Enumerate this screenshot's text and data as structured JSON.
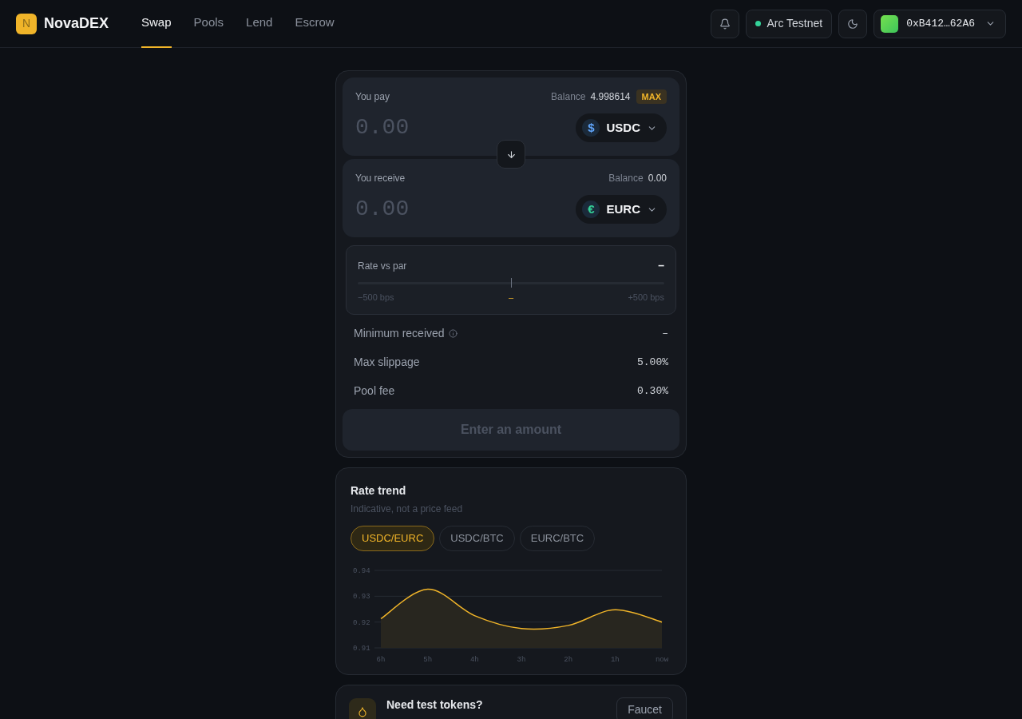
{
  "brand": {
    "logo": "N",
    "name": "NovaDEX"
  },
  "nav": [
    {
      "label": "Swap",
      "selected": true
    },
    {
      "label": "Pools",
      "selected": false
    },
    {
      "label": "Lend",
      "selected": false
    },
    {
      "label": "Escrow",
      "selected": false
    }
  ],
  "header": {
    "network": {
      "label": "Arc Testnet",
      "color": "#34d399"
    },
    "wallet": "0xB412…62A6"
  },
  "swap": {
    "pay": {
      "label": "You pay",
      "balance_label": "Balance",
      "balance": "4.998614",
      "max": "MAX",
      "placeholder": "0.00",
      "token": "USDC",
      "token_symbol": "$",
      "color": "#60a5fa"
    },
    "receive": {
      "label": "You receive",
      "balance_label": "Balance",
      "balance": "0.00",
      "placeholder": "0.00",
      "token": "EURC",
      "token_symbol": "€",
      "color": "#34d399"
    },
    "rate": {
      "label": "Rate vs par",
      "value": "–",
      "level": 0.5,
      "min": "−500 bps",
      "center": "–",
      "max": "+500 bps"
    },
    "details": [
      {
        "label": "Minimum received",
        "info": true,
        "value": "–"
      },
      {
        "label": "Max slippage",
        "info": false,
        "value": "5.00%"
      },
      {
        "label": "Pool fee",
        "info": false,
        "value": "0.30%"
      }
    ],
    "submit": {
      "label": "Enter an amount",
      "disabled": true
    }
  },
  "trend": {
    "title": "Rate trend",
    "subtitle": "Indicative, not a price feed",
    "pairs": [
      {
        "label": "USDC/EURC",
        "selected": true
      },
      {
        "label": "USDC/BTC",
        "selected": false
      },
      {
        "label": "EURC/BTC",
        "selected": false
      }
    ],
    "chart_data": {
      "type": "area",
      "categories": [
        "6h",
        "5h",
        "4h",
        "3h",
        "2h",
        "1h",
        "now"
      ],
      "series": [
        {
          "color": "#f0b429",
          "values": [
            0.9213,
            0.9327,
            0.9225,
            0.9175,
            0.9187,
            0.9248,
            0.92
          ]
        }
      ],
      "ylim": [
        0.91,
        0.94
      ],
      "yticks": [
        {
          "value": 0.91,
          "label": "0.91"
        },
        {
          "value": 0.92,
          "label": "0.92"
        },
        {
          "value": 0.93,
          "label": "0.93"
        },
        {
          "value": 0.94,
          "label": "0.94"
        }
      ]
    }
  },
  "faucet": {
    "title": "Need test tokens?",
    "button": "Faucet"
  }
}
